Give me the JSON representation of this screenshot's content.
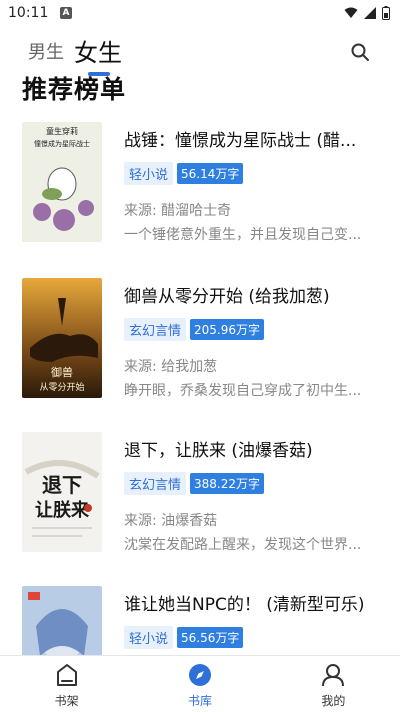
{
  "status": {
    "time": "10:11",
    "notif": "A"
  },
  "tabs": {
    "male": "男生",
    "female": "女生"
  },
  "section_title": "推荐榜单",
  "books": [
    {
      "title": "战锤：憧憬成为星际战士 (醋...",
      "category": "轻小说",
      "words": "56.14万字",
      "source": "来源: 醋溜哈士奇",
      "desc": "一个锤佬意外重生，并且发现自己变...",
      "cover_text": "童生穿莉 憧憬成为星际战士"
    },
    {
      "title": "御兽从零分开始 (给我加葱)",
      "category": "玄幻言情",
      "words": "205.96万字",
      "source": "来源: 给我加葱",
      "desc": "睁开眼，乔桑发现自己穿成了初中生...",
      "cover_text": "御兽 从零分开始"
    },
    {
      "title": "退下，让朕来 (油爆香菇)",
      "category": "玄幻言情",
      "words": "388.22万字",
      "source": "来源: 油爆香菇",
      "desc": "沈棠在发配路上醒来，发现这个世界...",
      "cover_text": "退下 让朕来!"
    },
    {
      "title": "谁让她当NPC的！ (清新型可乐)",
      "category": "轻小说",
      "words": "56.56万字",
      "source": "",
      "desc": "",
      "cover_text": ""
    }
  ],
  "nav": {
    "shelf": "书架",
    "library": "书库",
    "mine": "我的"
  },
  "colors": {
    "accent": "#2f6fd8",
    "tag_bg": "#e8f0fc",
    "words_bg": "#2f7fe0"
  }
}
